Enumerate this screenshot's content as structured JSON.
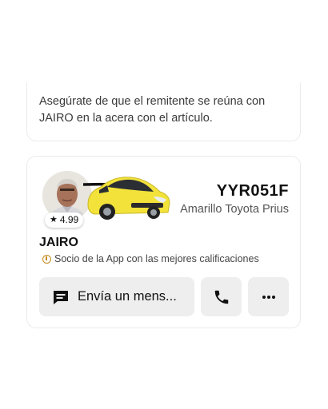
{
  "pickup_card": {
    "message": "Asegúrate de que el remitente se reúna con JAIRO en la acera con el artículo."
  },
  "driver": {
    "rating": "4.99",
    "name": "JAIRO",
    "badge": "Socio de la App con las mejores calificaciones",
    "plate": "YYR051F",
    "vehicle": "Amarillo Toyota Prius",
    "car_color": "#f2e23a"
  },
  "actions": {
    "message_label": "Envía un mens...",
    "call_icon": "phone-icon",
    "more_icon": "more-icon"
  }
}
